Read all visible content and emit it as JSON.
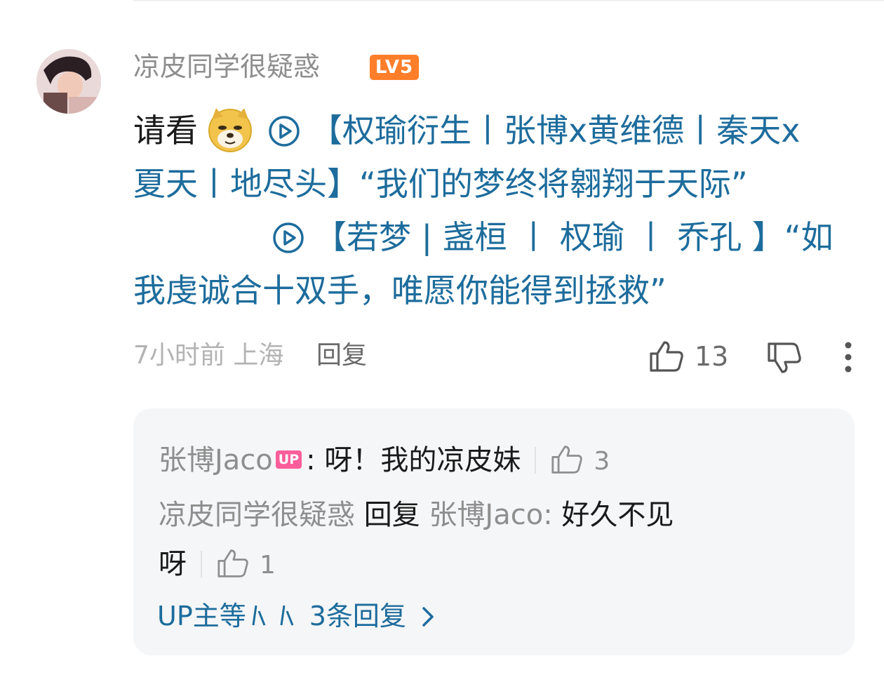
{
  "comment": {
    "username": "凉皮同学很疑惑",
    "level": "LV5",
    "text_prefix": "请看",
    "link1_line1": "【权瑜衍生丨张博x黄维德丨秦天x",
    "link1_line2": "夏天丨地尽头】“我们的梦终将翱翔于天际”",
    "link2_line1": "【若梦 | 盏桓 丨 权瑜 丨 乔孔 】“如",
    "link2_line2": "我虔诚合十双手，唯愿你能得到拯救”",
    "time_location": "7小时前 上海",
    "reply_label": "回复",
    "like_count": "13"
  },
  "replies": [
    {
      "author": "张博Jaco",
      "badge": "UP",
      "separator": ":",
      "text": "呀！我的凉皮妹",
      "likes": "3"
    },
    {
      "author": "凉皮同学很疑惑",
      "reply_word": "回复",
      "target": "张博Jaco:",
      "text_part1": "好久不见",
      "text_part2": "呀",
      "likes": "1"
    }
  ],
  "more_replies_text": "UP主等",
  "more_replies_count": "3条回复",
  "colors": {
    "link": "#1d6c9c",
    "level_badge": "#ff7e29",
    "up_badge": "#fb5e9a"
  }
}
